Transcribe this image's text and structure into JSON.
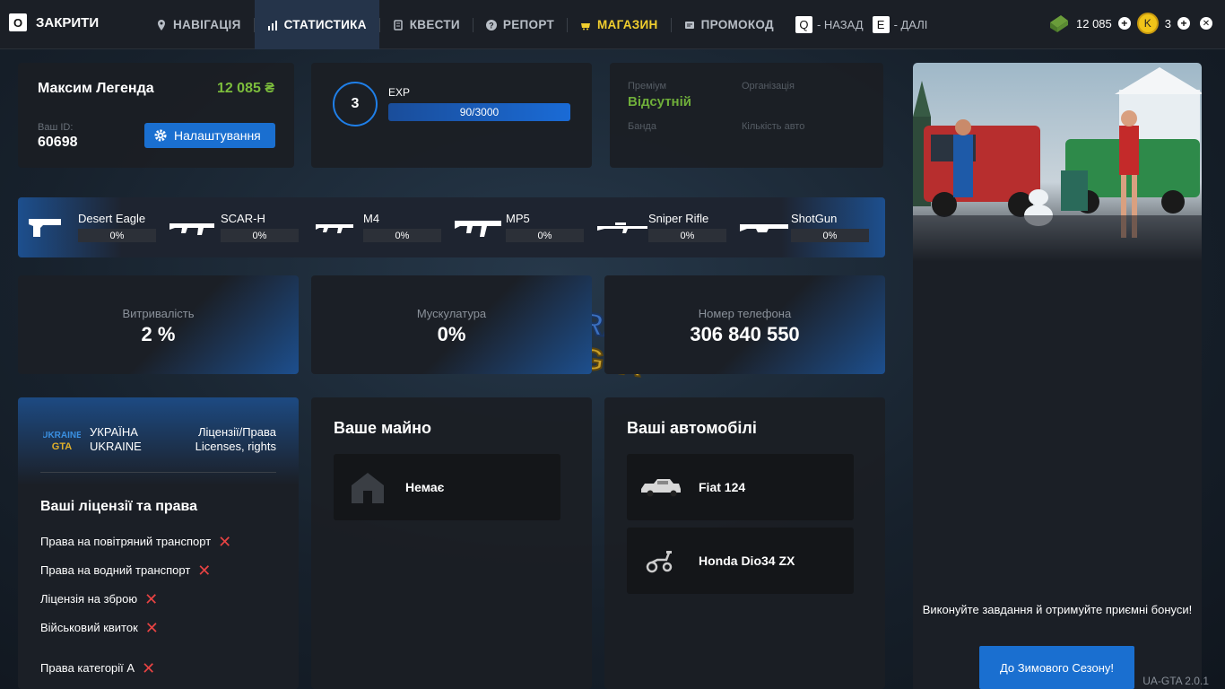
{
  "topbar": {
    "close_key": "O",
    "close_label": "ЗАКРИТИ",
    "nav": [
      {
        "label": "НАВІГАЦІЯ",
        "icon": "pin-icon"
      },
      {
        "label": "СТАТИСТИКА",
        "icon": "stats-icon",
        "active": true
      },
      {
        "label": "КВЕСТИ",
        "icon": "quest-icon"
      },
      {
        "label": "РЕПОРТ",
        "icon": "help-icon"
      },
      {
        "label": "МАГАЗИН",
        "icon": "shop-icon"
      },
      {
        "label": "ПРОМОКОД",
        "icon": "ticket-icon"
      }
    ],
    "back_key": "Q",
    "back_label": "- НАЗАД",
    "next_key": "E",
    "next_label": "- ДАЛІ",
    "money": "12 085",
    "coins_symbol": "K",
    "coins": "3",
    "accent_color": "#f2cf2e"
  },
  "profile": {
    "name": "Максим Легенда",
    "money": "12 085 ₴",
    "id_label": "Ваш ID:",
    "id": "60698",
    "settings_label": "Налаштування"
  },
  "level": {
    "level": "3",
    "exp_label": "EXP",
    "exp_text": "90/3000"
  },
  "info": {
    "premium_label": "Преміум",
    "premium_value": "Відсутній",
    "org_label": "Організація",
    "gang_label": "Банда",
    "cars_count_label": "Кількість авто"
  },
  "weapons": [
    {
      "name": "Desert Eagle",
      "value": "0%"
    },
    {
      "name": "SCAR-H",
      "value": "0%"
    },
    {
      "name": "M4",
      "value": "0%"
    },
    {
      "name": "MP5",
      "value": "0%"
    },
    {
      "name": "Sniper Rifle",
      "value": "0%"
    },
    {
      "name": "ShotGun",
      "value": "0%"
    }
  ],
  "stats": [
    {
      "label": "Витривалість",
      "value": "2 %"
    },
    {
      "label": "Мускулатура",
      "value": "0%"
    },
    {
      "label": "Номер телефона",
      "value": "306 840 550"
    }
  ],
  "licenses": {
    "country_line1": "УКРАЇНА",
    "country_line2": "UKRAINE",
    "type_line1": "Ліцензії/Права",
    "type_line2": "Licenses, rights",
    "title": "Ваші ліцензії та права",
    "items": [
      "Права на повітряний транспорт",
      "Права на водний транспорт",
      "Ліцензія на зброю",
      "Військовий квиток",
      "Права категорії А"
    ]
  },
  "property": {
    "title": "Ваше майно",
    "items": [
      "Немає"
    ]
  },
  "cars": {
    "title": "Ваші автомобілі",
    "items": [
      "Fiat 124",
      "Honda Dio34 ZX"
    ]
  },
  "promo": {
    "text": "Виконуйте завдання й отримуйте приємні бонуси!",
    "button": "До Зимового Сезону!"
  },
  "version": "UA-GTA 2.0.1"
}
